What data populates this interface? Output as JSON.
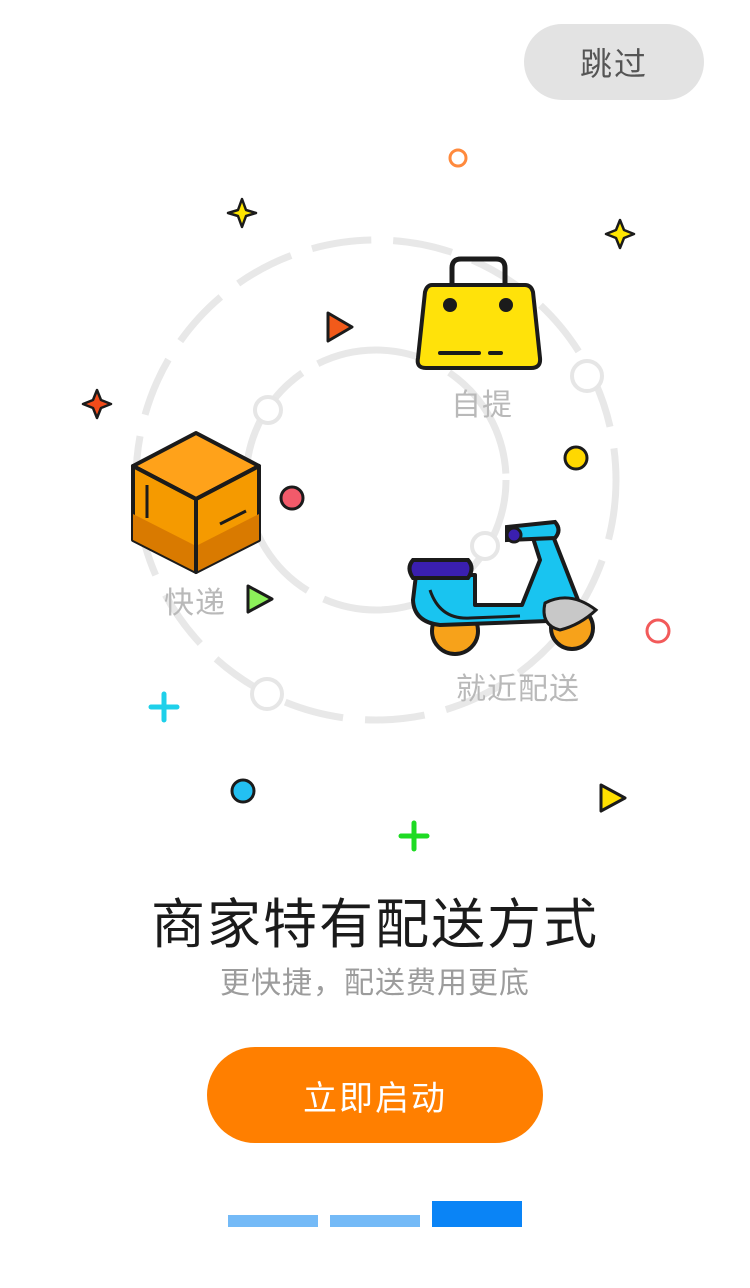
{
  "header": {
    "skip_label": "跳过"
  },
  "illustration": {
    "label_pickup": "自提",
    "label_express": "快递",
    "label_nearby": "就近配送"
  },
  "content": {
    "title": "商家特有配送方式",
    "subtitle": "更快捷，配送费用更底"
  },
  "footer": {
    "start_label": "立即启动",
    "pager": {
      "pages": 3,
      "active_index": 2
    }
  },
  "colors": {
    "accent": "#ff7f00",
    "pager_active": "#0a84f6",
    "pager_inactive": "#74baf7"
  }
}
